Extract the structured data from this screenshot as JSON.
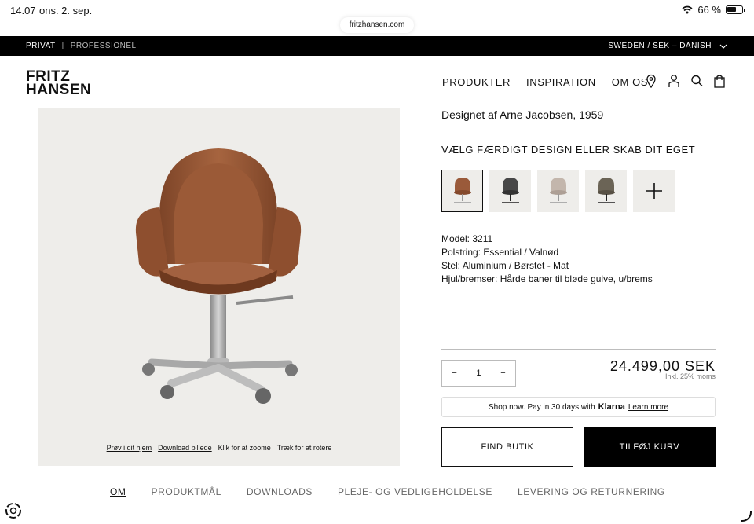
{
  "status_bar": {
    "time": "14.07",
    "date": "ons. 2. sep.",
    "url": "fritzhansen.com",
    "battery": "66 %"
  },
  "top_bar": {
    "segment_active": "PRIVAT",
    "separator": "|",
    "segment_inactive": "PROFESSIONEL",
    "locale": "SWEDEN / SEK – DANISH"
  },
  "header": {
    "logo_line1": "FRITZ",
    "logo_line2": "HANSEN",
    "nav": [
      "PRODUKTER",
      "INSPIRATION",
      "OM OS"
    ],
    "icons": [
      "location-icon",
      "account-icon",
      "search-icon",
      "bag-icon"
    ]
  },
  "image_panel": {
    "actions": [
      "Prøv i dit hjem",
      "Download billede",
      "Klik for at zoome",
      "Træk for at rotere"
    ]
  },
  "product": {
    "designer": "Designet af Arne Jacobsen, 1959",
    "choose_title": "VÆLG FÆRDIGT DESIGN ELLER SKAB DIT EGET",
    "swatch_colors": [
      "#9a5a3a",
      "#474747",
      "#c3b6ac",
      "#6b6456"
    ],
    "specs": [
      {
        "label": "Model:",
        "value": " 3211"
      },
      {
        "label": "Polstring:",
        "value": " Essential / Valnød"
      },
      {
        "label": "Stel:",
        "value": " Aluminium / Børstet - Mat"
      },
      {
        "label": "Hjul/bremser:",
        "value": " Hårde baner til bløde gulve, u/brems"
      }
    ],
    "quantity": {
      "minus": "−",
      "value": "1",
      "plus": "+"
    },
    "price": "24.499,00 SEK",
    "tax_note": "Inkl. 25% moms",
    "klarna": {
      "text": "Shop now. Pay in 30 days with",
      "brand": "Klarna",
      "link": "Learn more"
    },
    "find_store": "FIND BUTIK",
    "add_to_cart": "TILFØJ KURV"
  },
  "tabs": [
    "OM",
    "PRODUKTMÅL",
    "DOWNLOADS",
    "PLEJE- OG VEDLIGEHOLDELSE",
    "LEVERING OG RETURNERING"
  ],
  "colors": {
    "topbar": "#000000",
    "panel_bg": "#eeedea",
    "leather": "#9a5a3a",
    "accent_button": "#000000"
  }
}
